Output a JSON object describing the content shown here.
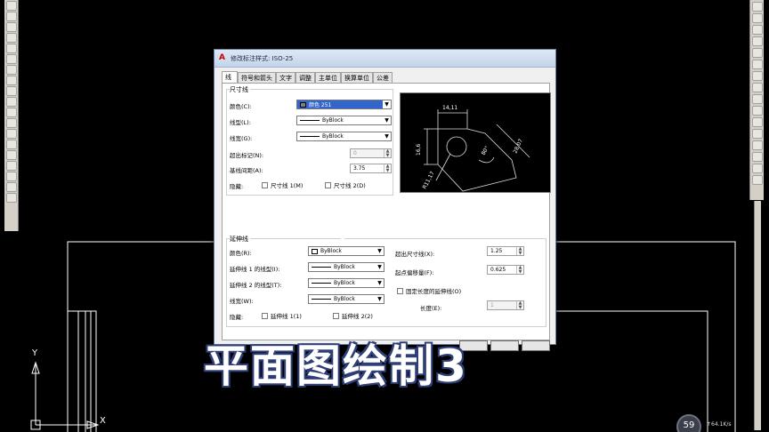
{
  "dialog": {
    "title": "修改标注样式: ISO-25",
    "tabs": [
      "线",
      "符号和箭头",
      "文字",
      "调整",
      "主单位",
      "换算单位",
      "公差"
    ],
    "active_tab": "线"
  },
  "dim_lines": {
    "group_label": "尺寸线",
    "color_label": "颜色(C):",
    "color_value": "颜色 251",
    "linetype_label": "线型(L):",
    "linetype_value": "ByBlock",
    "lineweight_label": "线宽(G):",
    "lineweight_value": "ByBlock",
    "extend_ticks_label": "超出标记(N):",
    "extend_ticks_value": "0",
    "baseline_spacing_label": "基线间距(A):",
    "baseline_spacing_value": "3.75",
    "suppress_label": "隐藏:",
    "suppress_1": "尺寸线 1(M)",
    "suppress_2": "尺寸线 2(D)"
  },
  "ext_lines": {
    "group_label": "延伸线",
    "color_label": "颜色(R):",
    "color_value": "ByBlock",
    "ext1_linetype_label": "延伸线 1 的线型(I):",
    "ext1_linetype_value": "ByBlock",
    "ext2_linetype_label": "延伸线 2 的线型(T):",
    "ext2_linetype_value": "ByBlock",
    "lineweight_label": "线宽(W):",
    "lineweight_value": "ByBlock",
    "suppress_label": "隐藏:",
    "suppress_1": "延伸线 1(1)",
    "suppress_2": "延伸线 2(2)",
    "extend_beyond_label": "超出尺寸线(X):",
    "extend_beyond_value": "1.25",
    "offset_label": "起点偏移量(F):",
    "offset_value": "0.625",
    "fixed_length_label": "固定长度的延伸线(O)",
    "length_label": "长度(E):",
    "length_value": "1"
  },
  "preview": {
    "dim_top": "14,11",
    "dim_left": "16,6",
    "dim_right": "28,07",
    "dim_angle": "80°",
    "dim_radius": "R11,17"
  },
  "axes": {
    "y": "Y",
    "x": "X"
  },
  "overlay_text": "平面图绘制3",
  "badge_value": "59",
  "speed_text": "↑64.1K/s",
  "colors": {
    "dim_color": "#7f7f7f",
    "selection": "#3366cc",
    "overlay_stroke": "#2f3f77"
  }
}
